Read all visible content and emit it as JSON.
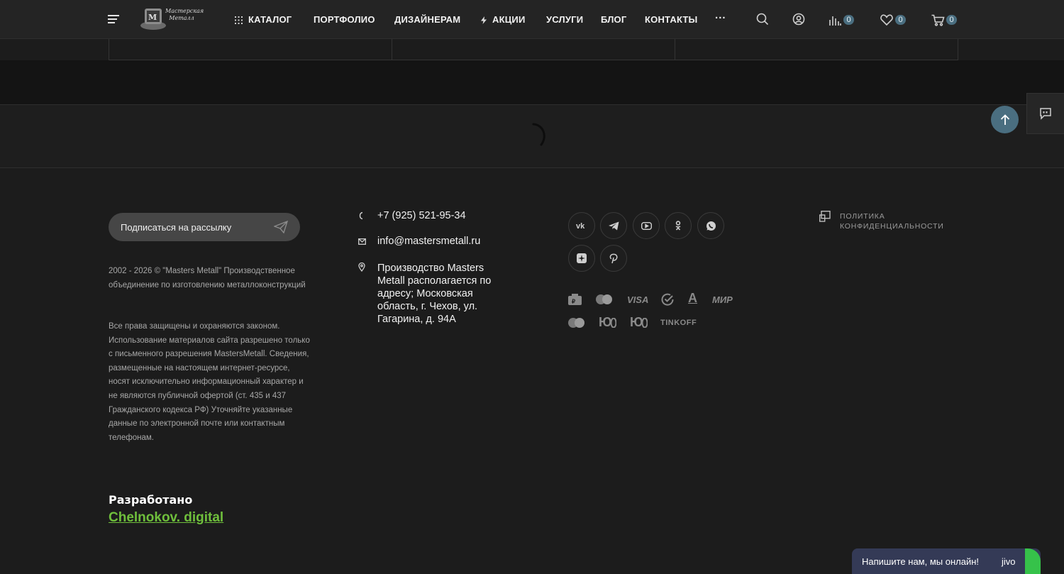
{
  "header": {
    "logo_text": "Мастерская Металл",
    "nav": [
      {
        "label": "КАТАЛОГ"
      },
      {
        "label": "ПОРТФОЛИО"
      },
      {
        "label": "ДИЗАЙНЕРАМ"
      },
      {
        "label": "АКЦИИ"
      },
      {
        "label": "УСЛУГИ"
      },
      {
        "label": "БЛОГ"
      },
      {
        "label": "КОНТАКТЫ"
      }
    ],
    "more_label": "···",
    "compare_count": "0",
    "favorites_count": "0",
    "cart_count": "0",
    "accent_color": "#4a6e80"
  },
  "footer": {
    "subscribe_label": "Подписаться на рассылку",
    "copyright": "2002 - 2026 © \"Masters Metall\" Производственное объединение по изготовлению металлоконструкций",
    "rights": "Все права защищены и охраняются законом. Использование материалов сайта разрешено только с письменного разрешения MastersMetall. Сведения, размещенные на настоящем интернет-ресурсе, носят исключительно информационный характер и не являются публичной офертой (ст. 435 и 437 Гражданского кодекса РФ) Уточняйте указанные данные по электронной почте или контактным телефонам.",
    "developed_by": "Разработано",
    "developer_link": "Chelnokov. digital",
    "phone": "+7 (925) 521-95-34",
    "email": "info@mastersmetall.ru",
    "address": "Производство Masters Metall располагается по адресу; Московская область, г. Чехов, ул. Гагарина, д. 94А",
    "social": [
      "vk-icon",
      "telegram-icon",
      "youtube-icon",
      "odnoklassniki-icon",
      "whatsapp-icon",
      "yandex-zen-icon",
      "pinterest-icon"
    ],
    "payments": {
      "visa": "VISA",
      "sber": "✓",
      "alfa": "A",
      "mir": "МИР",
      "yoomoney_1": "Ю",
      "yoomoney_2": "Ю",
      "tinkoff": "TINKOFF"
    },
    "policy": "Политика конфиденциальности"
  },
  "chat": {
    "text": "Напишите нам, мы онлайн!",
    "brand": "jivo"
  }
}
